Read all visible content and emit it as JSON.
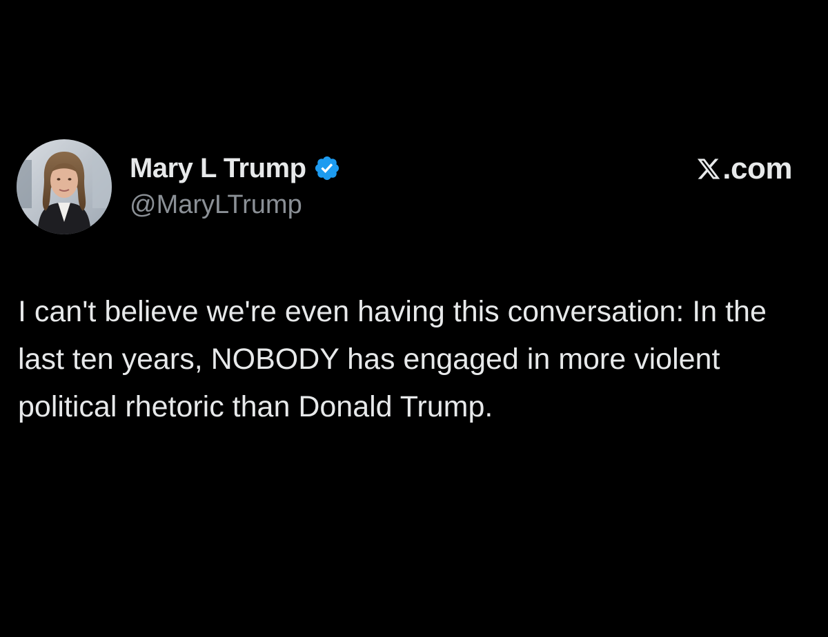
{
  "author": {
    "display_name": "Mary L Trump",
    "handle": "@MaryLTrump",
    "verified": true,
    "avatar": "profile-photo"
  },
  "site": {
    "logo": "x-logo-icon",
    "label": ".com"
  },
  "post": {
    "text": "I can't believe we're even having this conversation: In the last ten years, NOBODY has engaged in more violent political rhetoric than Donald Trump."
  },
  "colors": {
    "background": "#000000",
    "text": "#e7e9ea",
    "handle": "#8b9096",
    "verified": "#1d9bf0"
  }
}
